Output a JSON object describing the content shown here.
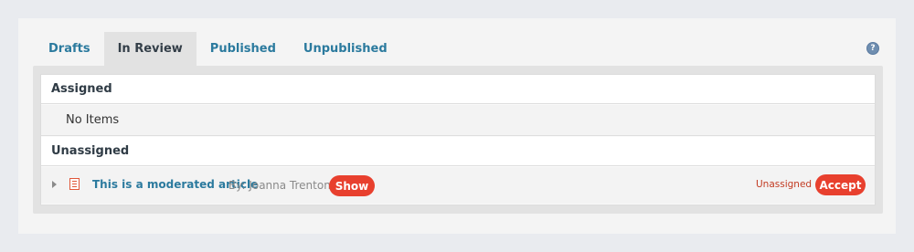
{
  "tabs": [
    {
      "label": "Drafts",
      "active": false
    },
    {
      "label": "In Review",
      "active": true
    },
    {
      "label": "Published",
      "active": false
    },
    {
      "label": "Unpublished",
      "active": false
    }
  ],
  "help_icon": {
    "glyph": "?",
    "icon": "help-icon"
  },
  "sections": {
    "assigned": {
      "title": "Assigned",
      "empty_text": "No Items"
    },
    "unassigned": {
      "title": "Unassigned",
      "items": [
        {
          "title": "This is a moderated article",
          "author": "By: Joanna Trenton",
          "show_label": "Show",
          "status": "Unassigned",
          "accept_label": "Accept"
        }
      ]
    }
  },
  "colors": {
    "accent": "#e8402e",
    "link": "#2b7a9e",
    "status": "#c23b22"
  }
}
